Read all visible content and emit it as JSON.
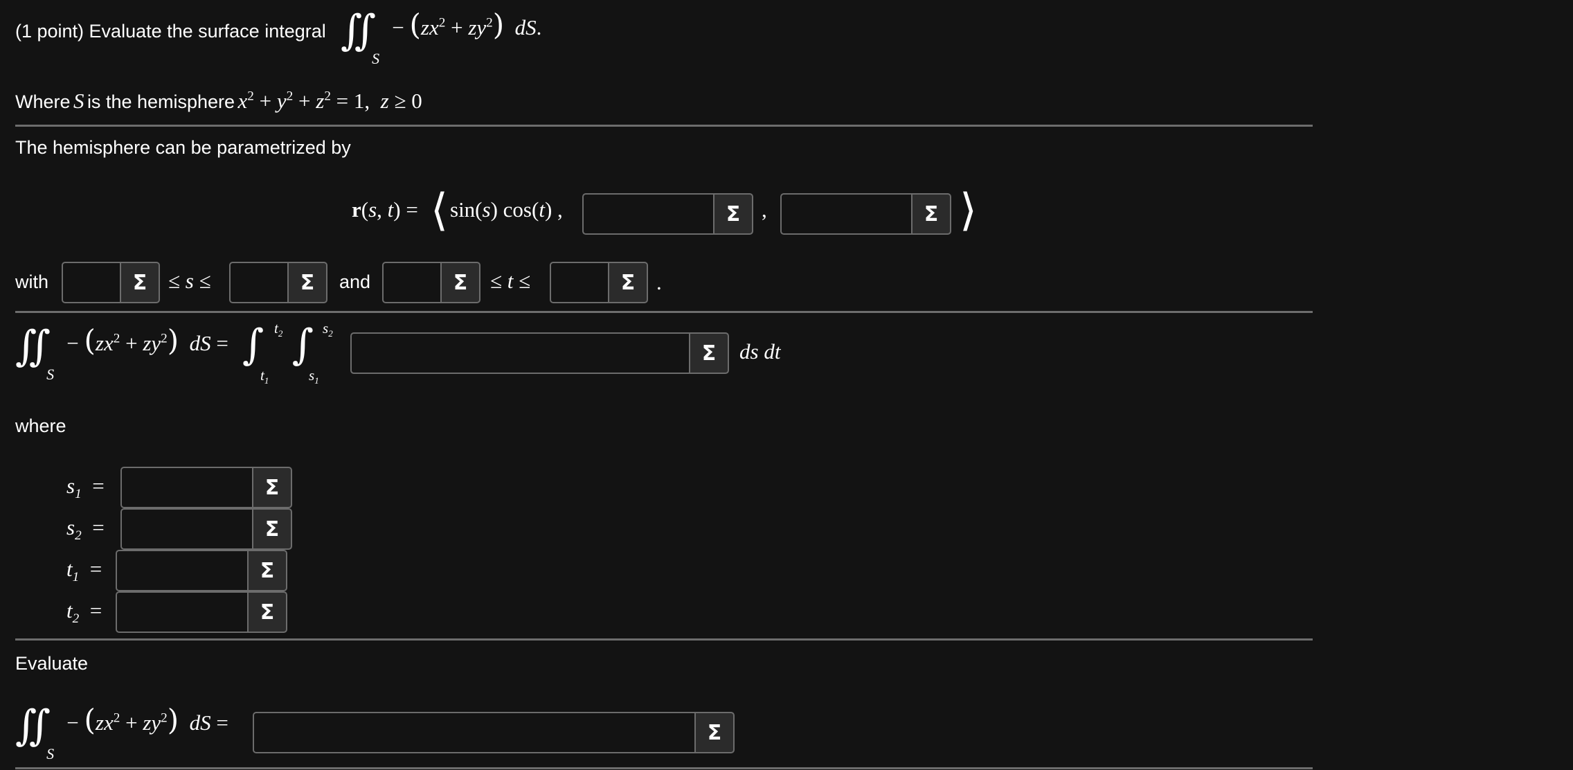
{
  "problem": {
    "intro": "(1 point) Evaluate the surface integral",
    "where_prefix": "Where",
    "is_the_hemisphere": "is the hemisphere",
    "param_text": "The hemisphere can be parametrized by",
    "with_label": "with",
    "and_label": "and",
    "where_label": "where",
    "evaluate_label": "Evaluate",
    "ds_dt": "ds dt"
  },
  "icons": {
    "equation_editor": "sigma-icon"
  },
  "inputs": {
    "r_y": "",
    "r_z": "",
    "s_lower": "",
    "s_upper": "",
    "t_lower": "",
    "t_upper": "",
    "integrand": "",
    "s1": "",
    "s2": "",
    "t1": "",
    "t2": "",
    "final": ""
  }
}
